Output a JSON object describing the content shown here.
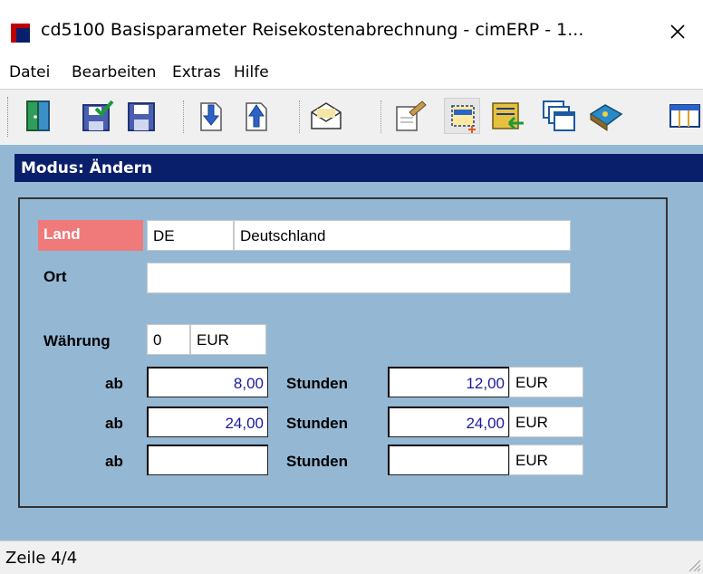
{
  "window": {
    "title": "cd5100 Basisparameter Reisekostenabrechnung - cimERP - 1...",
    "close_glyph": "✕"
  },
  "menu": [
    "Datei",
    "Bearbeiten",
    "Extras",
    "Hilfe"
  ],
  "toolbar": {
    "icons": [
      "exit-door-icon",
      "save-check-icon",
      "save-icon",
      "import-down-icon",
      "export-up-icon",
      "mail-icon",
      "edit-document-icon",
      "new-record-icon",
      "list-transfer-icon",
      "windows-icon",
      "book-icon",
      "table-icon"
    ]
  },
  "mode": {
    "label": "Modus: Ändern"
  },
  "form": {
    "land_label": "Land",
    "land_code": "DE",
    "land_name": "Deutschland",
    "ort_label": "Ort",
    "ort_value": "",
    "waehrung_label": "Währung",
    "waehrung_code": "0",
    "waehrung_name": "EUR",
    "rows": [
      {
        "ab_label": "ab",
        "ab_value": "8,00",
        "stunden_label": "Stunden",
        "amount": "12,00",
        "currency": "EUR"
      },
      {
        "ab_label": "ab",
        "ab_value": "24,00",
        "stunden_label": "Stunden",
        "amount": "24,00",
        "currency": "EUR"
      },
      {
        "ab_label": "ab",
        "ab_value": "",
        "stunden_label": "Stunden",
        "amount": "",
        "currency": "EUR"
      }
    ]
  },
  "status": {
    "text": "Zeile 4/4"
  },
  "colors": {
    "mode_bar": "#0a1f6b",
    "content_bg": "#94b8d4",
    "land_highlight": "#f07a7a",
    "value_text": "#1a1aa0"
  }
}
